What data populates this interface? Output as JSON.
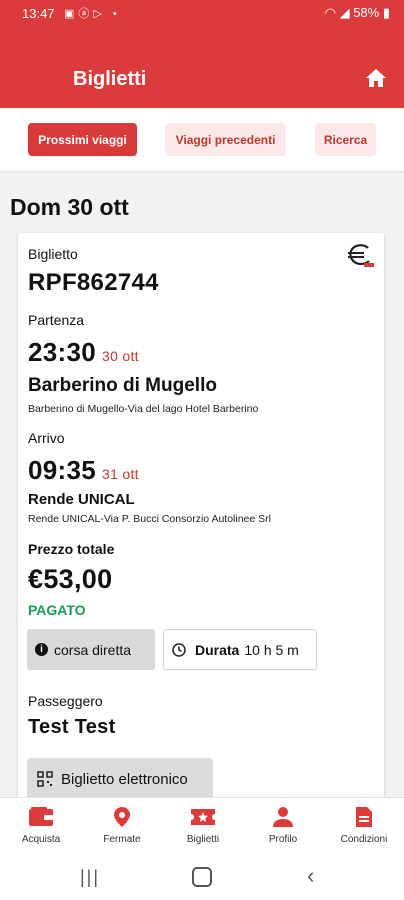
{
  "status_bar": {
    "time": "13:47",
    "battery": "58%"
  },
  "header": {
    "title": "Biglietti"
  },
  "tabs": [
    {
      "label": "Prossimi viaggi",
      "active": true
    },
    {
      "label": "Viaggi precedenti",
      "active": false
    },
    {
      "label": "Ricerca",
      "active": false
    }
  ],
  "date_heading": "Dom 30 ott",
  "ticket": {
    "ticket_label": "Biglietto",
    "ticket_code": "RPF862744",
    "departure_label": "Partenza",
    "departure_time": "23:30",
    "departure_date": "30 ott",
    "departure_stop": "Barberino di Mugello",
    "departure_address": "Barberino di Mugello-Via del lago Hotel Barberino",
    "arrival_label": "Arrivo",
    "arrival_time": "09:35",
    "arrival_date": "31 ott",
    "arrival_stop": "Rende UNICAL",
    "arrival_address": "Rende UNICAL-Via P. Bucci Consorzio Autolinee Srl",
    "price_label": "Prezzo totale",
    "price": "€53,00",
    "payment_status": "PAGATO",
    "direct_label": "corsa diretta",
    "duration_label": "Durata",
    "duration_value": "10 h 5 m",
    "passenger_label": "Passeggero",
    "passenger_name": "Test Test",
    "eticket_button": "Biglietto elettronico"
  },
  "bottom_nav": [
    {
      "label": "Acquista",
      "icon": "wallet-icon"
    },
    {
      "label": "Fermate",
      "icon": "map-pin-icon"
    },
    {
      "label": "Biglietti",
      "icon": "ticket-icon"
    },
    {
      "label": "Profilo",
      "icon": "person-icon"
    },
    {
      "label": "Condizioni",
      "icon": "document-icon"
    }
  ],
  "colors": {
    "brand_red": "#dc3b3b",
    "paid_green": "#1a9c55",
    "accent_red_text": "#c0392b"
  }
}
